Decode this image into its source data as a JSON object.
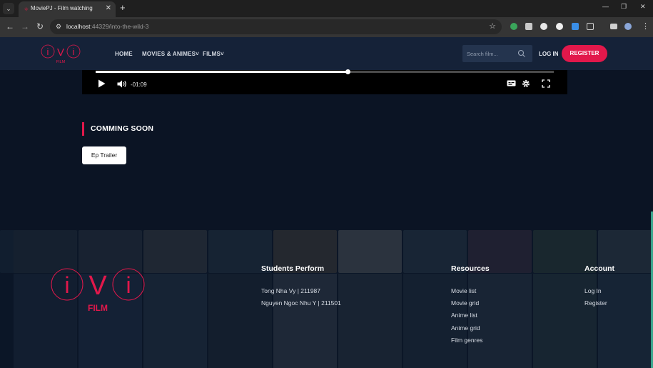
{
  "browser": {
    "tab_title": "MoviePJ - Film watching",
    "url_host": "localhost",
    "url_path": ":44329/into-the-wild-3"
  },
  "header": {
    "logo_text": "iVi",
    "logo_sub": "FILM",
    "nav": [
      "HOME",
      "MOVIES & ANIMES",
      "FILMS"
    ],
    "search_placeholder": "Search film...",
    "login_label": "LOG IN",
    "register_label": "REGISTER"
  },
  "player": {
    "time_remaining": "-01:09",
    "progress": 0.55
  },
  "section": {
    "title": "COMMING SOON",
    "episode_button": "Ep Trailer"
  },
  "footer": {
    "logo_text": "iVi",
    "logo_sub": "FILM",
    "students_heading": "Students Perform",
    "students": [
      "Tong Nha Vy | 211987",
      "Nguyen Ngoc Nhu Y | 211501"
    ],
    "resources_heading": "Resources",
    "resources": [
      "Movie list",
      "Movie grid",
      "Anime list",
      "Anime grid",
      "Film genres"
    ],
    "account_heading": "Account",
    "account": [
      "Log In",
      "Register"
    ]
  },
  "colors": {
    "accent": "#e2184b",
    "header_bg": "#152238",
    "page_bg": "#0b1424"
  },
  "icons": [
    "menu-icon",
    "close-icon",
    "plus-icon",
    "back-icon",
    "forward-icon",
    "reload-icon",
    "site-info-icon",
    "star-icon",
    "extensions-icon",
    "more-icon",
    "search-icon",
    "play-icon",
    "volume-icon",
    "captions-icon",
    "gear-icon",
    "fullscreen-icon",
    "chevron-down-icon"
  ]
}
